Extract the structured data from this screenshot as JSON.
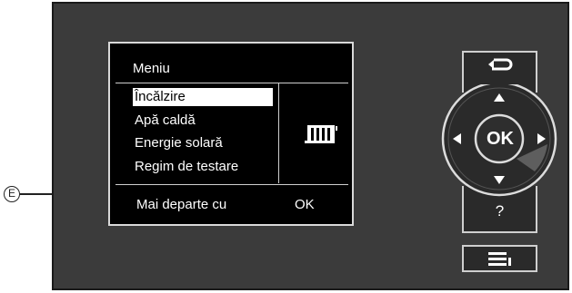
{
  "screen": {
    "title": "Meniu",
    "menu_items": [
      {
        "label": "Încălzire",
        "selected": true
      },
      {
        "label": "Apă caldă",
        "selected": false
      },
      {
        "label": "Energie solară",
        "selected": false
      },
      {
        "label": "Regim de testare",
        "selected": false
      }
    ],
    "footer": {
      "left": "Mai departe cu",
      "right": "OK"
    },
    "status_icon": "radiator-icon"
  },
  "callout": {
    "label": "E"
  },
  "controls": {
    "back_icon": "back-arrow-icon",
    "ok_label": "OK",
    "help_label": "?",
    "menu_icon": "menu-icon",
    "arrows": [
      "up-arrow-icon",
      "down-arrow-icon",
      "left-arrow-icon",
      "right-arrow-icon"
    ]
  }
}
